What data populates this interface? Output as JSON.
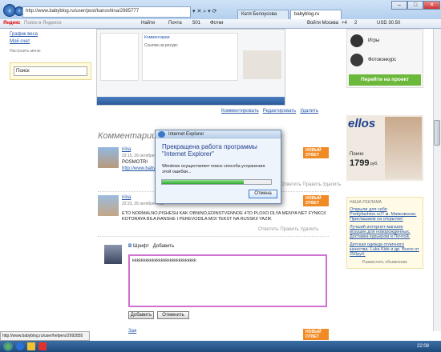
{
  "browser": {
    "url": "http://www.babyblog.ru/user/post/kanoshina/2985777",
    "tabs": [
      "Катя Белоусова",
      "babyblog.ru"
    ],
    "window_controls": [
      "–",
      "□",
      "✕"
    ]
  },
  "toolbar": {
    "yandex": "Яндекс",
    "search_placeholder": "Поиск в Яндексе",
    "find": "Найти",
    "mail": "Почта",
    "mail_count": "501",
    "photos": "Фотки",
    "login": "Войти Москва",
    "weather": "+4",
    "weather2": "2",
    "usd": "USD 30.50"
  },
  "left": {
    "items": [
      "График веса",
      "Мой счет"
    ],
    "settings": "Настроить меню",
    "search_value": "Поиск"
  },
  "post": {
    "actions": [
      "Комментировать",
      "Редактировать",
      "Удалить"
    ],
    "inner_labels": [
      "Комментарии",
      "Ссылка на ресурс",
      "Новое"
    ]
  },
  "comments_title": "Комментарии",
  "comments": [
    {
      "user": "irina",
      "date": "22:15, 26 октября 2011",
      "text": "POSMOTRI",
      "extra": "http://www.babyblog.ru",
      "badge": "НОВЫЙ ОТВЕТ",
      "actions": [
        "Ответить",
        "Править",
        "Удалить"
      ]
    },
    {
      "user": "irina",
      "date": "22:23, 26 октября 2011",
      "text": "ETO NORMALNO,PISHESH KAK OBNINO,EDINSTVENNOE 4TO PLOXO DLYA MENYA NET FYNKCII KOTORAYA BILA RANSHE I PEREVODILA MOI TEKST NA RUSSKII YAZIK",
      "badge": "НОВЫЙ ОТВЕТ",
      "actions": [
        "Ответить",
        "Править",
        "Удалить"
      ]
    },
    {
      "user": "Зая",
      "date": "",
      "text": "",
      "badge": "НОВЫЙ ОТВЕТ"
    }
  ],
  "editor": {
    "font": "Шрифт",
    "add": "Добавить",
    "text": "kkkkkkkkkkkkkkkkkkkkkkkkkkkkk",
    "submit": "Добавить",
    "cancel": "Отменить"
  },
  "dialog": {
    "title": "Internet Explorer",
    "heading": "Прекращена работа программы \"Internet Explorer\"",
    "body": "Windows осуществляет поиск способа устранения этой ошибки...",
    "progress": 0.75,
    "cancel": "Отмена"
  },
  "ads": {
    "games": "Игры",
    "photo_contest": "Фотоконкурс",
    "go_project": "Перейти на проект",
    "ellos_brand": "ellos",
    "ellos_price_label": "Пончо",
    "ellos_price": "1799",
    "ellos_currency": "руб.",
    "section_title": "НАША РЕКЛАМА",
    "links": [
      "Открыли для себя Prettyfashion.ru!!! м. Маяковская. Приглашаем на открытие!",
      "Лучший интернет-магазин игрушек для новорожденных. Доставка курьером и Почтой.",
      "Детская одежда отличного качества. Luka Kids и др. Всего от 250руб."
    ],
    "sponsor": "Разместить объявление"
  },
  "status_url": "http://www.babyblog.ru/user/helpers/2992855",
  "taskbar_time": "22:08",
  "colors": {
    "accent": "#2255aa",
    "badge": "#f08a24",
    "editor_border": "#d070d0"
  }
}
